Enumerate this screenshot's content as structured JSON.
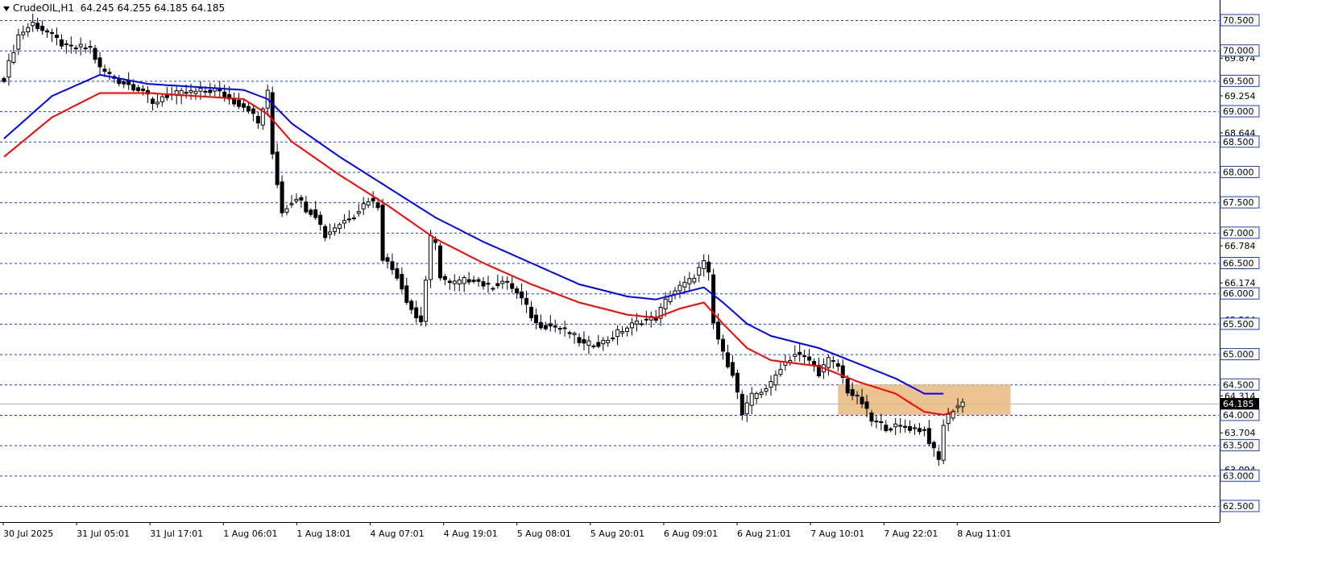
{
  "header": {
    "symbol": "CrudeOIL,H1",
    "ohlc": "64.245 64.255 64.185 64.185"
  },
  "colors": {
    "background": "#ffffff",
    "grid": "#1f3fbf",
    "candle": "#000000",
    "ma_fast": "#ff0000",
    "ma_slow": "#0000ff",
    "zone": "#e6b87d",
    "price_line": "#b0b0b0",
    "price_tag_bg": "#000000",
    "price_tag_text": "#ffffff"
  },
  "chart_data": {
    "type": "candlestick",
    "ylim": [
      62.3,
      70.75
    ],
    "grid_levels": [
      70.5,
      70.0,
      69.5,
      69.0,
      68.5,
      68.0,
      67.5,
      67.0,
      66.5,
      66.0,
      65.5,
      65.0,
      64.5,
      64.0,
      63.5,
      63.0,
      62.5
    ],
    "y_tick_labels": [
      "70.500",
      "70.000",
      "69.500",
      "69.000",
      "68.500",
      "68.000",
      "67.500",
      "67.000",
      "66.500",
      "66.000",
      "65.500",
      "65.000",
      "64.500",
      "64.000",
      "63.500",
      "63.000",
      "62.500"
    ],
    "extra_ticks": [
      {
        "value": 69.874,
        "label": "69.874"
      },
      {
        "value": 69.254,
        "label": "69.254"
      },
      {
        "value": 68.644,
        "label": "68.644"
      },
      {
        "value": 66.784,
        "label": "66.784"
      },
      {
        "value": 66.174,
        "label": "66.174"
      },
      {
        "value": 65.564,
        "label": "65.564"
      },
      {
        "value": 64.954,
        "label": "64.954"
      },
      {
        "value": 64.314,
        "label": "64.314"
      },
      {
        "value": 63.704,
        "label": "63.704"
      },
      {
        "value": 63.094,
        "label": "63.094"
      }
    ],
    "current_price": {
      "value": 64.185,
      "label": "64.185"
    },
    "x_labels": [
      "30 Jul 2025",
      "31 Jul 05:01",
      "31 Jul 17:01",
      "1 Aug 06:01",
      "1 Aug 18:01",
      "4 Aug 07:01",
      "4 Aug 19:01",
      "5 Aug 08:01",
      "5 Aug 20:01",
      "6 Aug 09:01",
      "6 Aug 21:01",
      "7 Aug 10:01",
      "7 Aug 22:01",
      "8 Aug 11:01"
    ],
    "close_waypoints": [
      [
        0,
        69.55
      ],
      [
        3,
        70.25
      ],
      [
        6,
        70.45
      ],
      [
        9,
        70.3
      ],
      [
        13,
        70.05
      ],
      [
        18,
        70.05
      ],
      [
        20,
        69.7
      ],
      [
        24,
        69.5
      ],
      [
        29,
        69.35
      ],
      [
        31,
        69.1
      ],
      [
        33,
        69.25
      ],
      [
        38,
        69.3
      ],
      [
        44,
        69.35
      ],
      [
        47,
        69.2
      ],
      [
        51,
        69.05
      ],
      [
        53,
        68.8
      ],
      [
        55,
        69.3
      ],
      [
        56,
        68.3
      ],
      [
        58,
        67.35
      ],
      [
        61,
        67.6
      ],
      [
        63,
        67.4
      ],
      [
        65,
        67.3
      ],
      [
        67,
        66.95
      ],
      [
        69,
        67.1
      ],
      [
        73,
        67.3
      ],
      [
        76,
        67.55
      ],
      [
        78,
        67.45
      ],
      [
        79,
        66.6
      ],
      [
        82,
        66.3
      ],
      [
        84,
        65.9
      ],
      [
        86,
        65.6
      ],
      [
        87,
        65.55
      ],
      [
        89,
        66.9
      ],
      [
        90,
        66.8
      ],
      [
        91,
        66.3
      ],
      [
        93,
        66.15
      ],
      [
        98,
        66.25
      ],
      [
        101,
        66.1
      ],
      [
        104,
        66.2
      ],
      [
        106,
        66.1
      ],
      [
        108,
        65.9
      ],
      [
        111,
        65.5
      ],
      [
        115,
        65.45
      ],
      [
        118,
        65.35
      ],
      [
        121,
        65.15
      ],
      [
        125,
        65.2
      ],
      [
        129,
        65.4
      ],
      [
        133,
        65.55
      ],
      [
        136,
        65.6
      ],
      [
        139,
        66.0
      ],
      [
        143,
        66.2
      ],
      [
        146,
        66.5
      ],
      [
        147,
        66.3
      ],
      [
        148,
        65.5
      ],
      [
        150,
        65.0
      ],
      [
        152,
        64.7
      ],
      [
        154,
        64.0
      ],
      [
        156,
        64.3
      ],
      [
        158,
        64.4
      ],
      [
        160,
        64.5
      ],
      [
        162,
        64.8
      ],
      [
        165,
        65.0
      ],
      [
        168,
        64.9
      ],
      [
        170,
        64.7
      ],
      [
        172,
        64.9
      ],
      [
        174,
        64.8
      ],
      [
        176,
        64.4
      ],
      [
        179,
        64.2
      ],
      [
        181,
        63.9
      ],
      [
        184,
        63.8
      ],
      [
        188,
        63.8
      ],
      [
        192,
        63.75
      ],
      [
        194,
        63.4
      ],
      [
        195,
        63.25
      ],
      [
        196,
        63.85
      ],
      [
        198,
        64.1
      ],
      [
        200,
        64.2
      ]
    ],
    "ma_fast_waypoints": [
      [
        0,
        68.25
      ],
      [
        10,
        68.9
      ],
      [
        20,
        69.3
      ],
      [
        30,
        69.3
      ],
      [
        40,
        69.25
      ],
      [
        50,
        69.2
      ],
      [
        55,
        68.95
      ],
      [
        60,
        68.5
      ],
      [
        70,
        67.95
      ],
      [
        80,
        67.45
      ],
      [
        90,
        66.9
      ],
      [
        100,
        66.5
      ],
      [
        110,
        66.15
      ],
      [
        120,
        65.85
      ],
      [
        130,
        65.65
      ],
      [
        136,
        65.6
      ],
      [
        141,
        65.75
      ],
      [
        146,
        65.85
      ],
      [
        150,
        65.5
      ],
      [
        155,
        65.1
      ],
      [
        160,
        64.9
      ],
      [
        170,
        64.8
      ],
      [
        178,
        64.55
      ],
      [
        186,
        64.35
      ],
      [
        192,
        64.05
      ],
      [
        196,
        64.0
      ],
      [
        198,
        64.05
      ]
    ],
    "ma_slow_waypoints": [
      [
        0,
        68.55
      ],
      [
        10,
        69.25
      ],
      [
        20,
        69.6
      ],
      [
        30,
        69.45
      ],
      [
        40,
        69.4
      ],
      [
        50,
        69.35
      ],
      [
        55,
        69.2
      ],
      [
        60,
        68.8
      ],
      [
        70,
        68.25
      ],
      [
        80,
        67.75
      ],
      [
        90,
        67.25
      ],
      [
        100,
        66.85
      ],
      [
        110,
        66.5
      ],
      [
        120,
        66.15
      ],
      [
        130,
        65.95
      ],
      [
        136,
        65.9
      ],
      [
        141,
        66.0
      ],
      [
        146,
        66.1
      ],
      [
        150,
        65.85
      ],
      [
        155,
        65.5
      ],
      [
        160,
        65.3
      ],
      [
        170,
        65.1
      ],
      [
        178,
        64.85
      ],
      [
        186,
        64.6
      ],
      [
        192,
        64.35
      ],
      [
        196,
        64.35
      ]
    ],
    "bar_count": 201,
    "zone": {
      "bar_start": 174,
      "bar_end": 210,
      "y_top": 64.5,
      "y_bottom": 64.0
    }
  }
}
